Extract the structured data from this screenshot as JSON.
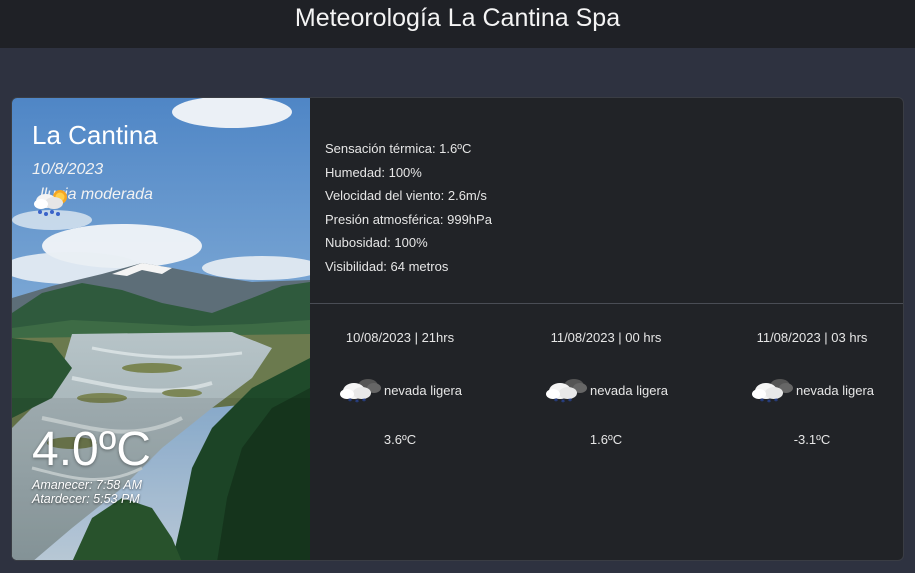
{
  "header": {
    "title": "Meteorología La Cantina Spa"
  },
  "current": {
    "city": "La Cantina",
    "date": "10/8/2023",
    "condition": "lluvia moderada",
    "condition_icon": "rain-snow-sun-icon",
    "temperature": "4.0ºC",
    "sunrise": "Amanecer: 7:58 AM",
    "sunset": "Atardecer: 5:53 PM"
  },
  "details": {
    "feels_like": "Sensación térmica: 1.6ºC",
    "humidity": "Humedad: 100%",
    "wind": "Velocidad del viento: 2.6m/s",
    "pressure": "Presión atmosférica: 999hPa",
    "clouds": "Nubosidad: 100%",
    "visibility": "Visibilidad: 64 metros"
  },
  "forecast": [
    {
      "time": "10/08/2023 | 21hrs",
      "condition": "nevada ligera",
      "icon": "snow-cloud-icon",
      "temp": "3.6ºC"
    },
    {
      "time": "11/08/2023 | 00 hrs",
      "condition": "nevada ligera",
      "icon": "snow-cloud-icon",
      "temp": "1.6ºC"
    },
    {
      "time": "11/08/2023 | 03 hrs",
      "condition": "nevada ligera",
      "icon": "snow-cloud-icon",
      "temp": "-3.1ºC"
    }
  ]
}
